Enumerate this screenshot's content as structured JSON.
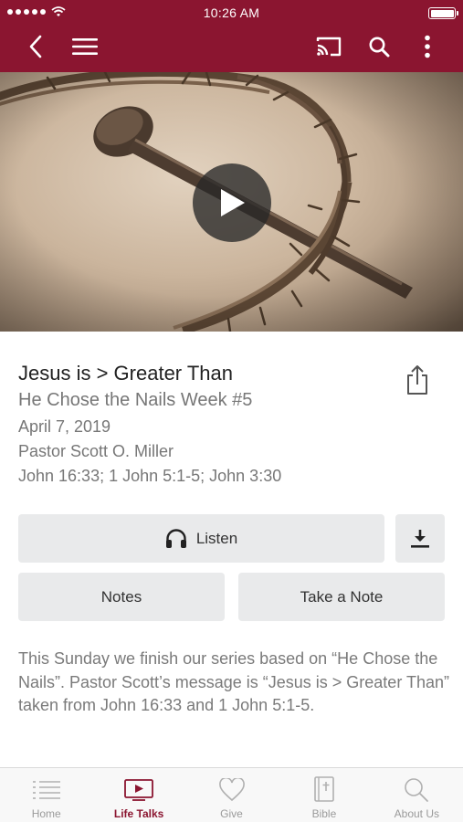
{
  "status_bar": {
    "time": "10:26 AM"
  },
  "nav": {
    "icons": [
      "back-icon",
      "menu-icon",
      "cast-icon",
      "search-icon",
      "more-icon"
    ]
  },
  "colors": {
    "brand": "#8b1530",
    "button_bg": "#e9eaeb",
    "muted_text": "#777777"
  },
  "sermon": {
    "title": "Jesus is > Greater Than",
    "subtitle": "He Chose the Nails Week #5",
    "date": "April 7, 2019",
    "pastor": "Pastor Scott O. Miller",
    "scripture": "John 16:33; 1 John 5:1-5; John 3:30",
    "description": "This Sunday we finish our series based on “He Chose the Nails”. Pastor Scott’s message is “Jesus is > Greater Than” taken from John 16:33 and 1 John 5:1-5."
  },
  "actions": {
    "listen_label": "Listen",
    "notes_label": "Notes",
    "take_note_label": "Take a Note"
  },
  "tabs": [
    {
      "label": "Home",
      "icon": "list-icon",
      "active": false
    },
    {
      "label": "Life Talks",
      "icon": "video-icon",
      "active": true
    },
    {
      "label": "Give",
      "icon": "heart-icon",
      "active": false
    },
    {
      "label": "Bible",
      "icon": "bible-icon",
      "active": false
    },
    {
      "label": "About Us",
      "icon": "search-icon",
      "active": false
    }
  ]
}
